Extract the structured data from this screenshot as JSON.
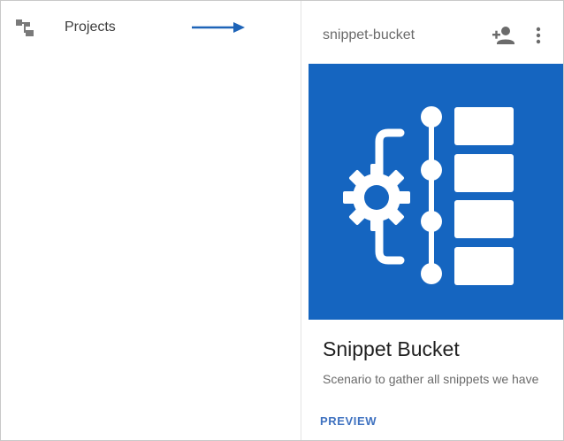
{
  "nav": {
    "projects_label": "Projects",
    "icon": "tree-structure-icon"
  },
  "annotation": {
    "arrow_color": "#1e64b8"
  },
  "card": {
    "header_title": "snippet-bucket",
    "title": "Snippet Bucket",
    "description": "Scenario to gather all snippets we have",
    "action_label": "PREVIEW",
    "image_background": "#1565c0",
    "image_icon": "gear-bracket-list-icon",
    "header_icons": [
      "add-person-icon",
      "more-vert-icon"
    ],
    "accent_color": "#3f72c0"
  }
}
